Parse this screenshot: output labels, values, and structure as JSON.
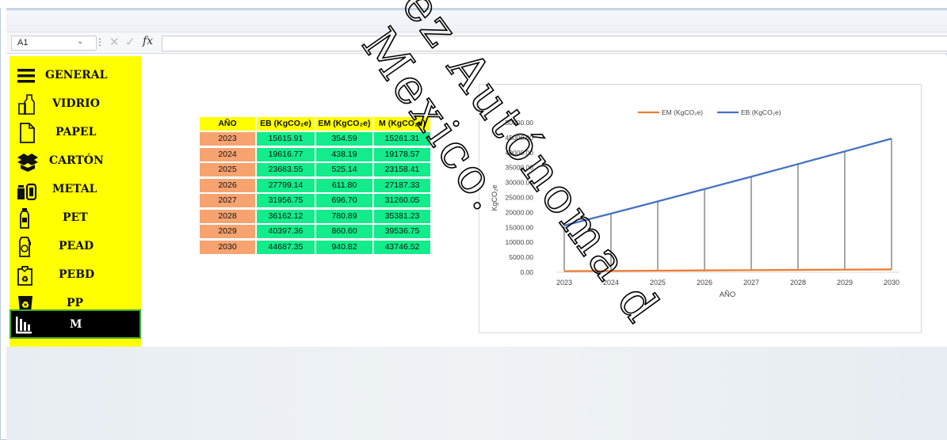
{
  "formula_bar": {
    "name_box": "A1",
    "fx": "fx"
  },
  "menu": {
    "items": [
      {
        "label": "GENERAL",
        "icon": "hamburger-icon"
      },
      {
        "label": "VIDRIO",
        "icon": "bottle-jar-icon"
      },
      {
        "label": "PAPEL",
        "icon": "paper-sheet-icon"
      },
      {
        "label": "CARTÓN",
        "icon": "cardboard-box-icon"
      },
      {
        "label": "METAL",
        "icon": "metal-can-icon"
      },
      {
        "label": "PET",
        "icon": "pet-bottle-icon"
      },
      {
        "label": "PEAD",
        "icon": "detergent-bottle-icon"
      },
      {
        "label": "PEBD",
        "icon": "plastic-bag-recycle-icon"
      },
      {
        "label": "PP",
        "icon": "recycle-bin-icon"
      },
      {
        "label": "M",
        "icon": "bar-chart-icon"
      }
    ],
    "active": "M"
  },
  "table": {
    "headers": [
      "AÑO",
      "EB (KgCO₂e)",
      "EM (KgCO₂e)",
      "M (KgCO₂e)"
    ],
    "rows": [
      [
        "2023",
        "15615.91",
        "354.59",
        "15261.31"
      ],
      [
        "2024",
        "19616.77",
        "438.19",
        "19178.57"
      ],
      [
        "2025",
        "23683.55",
        "525.14",
        "23158.41"
      ],
      [
        "2026",
        "27799.14",
        "611.80",
        "27187.33"
      ],
      [
        "2027",
        "31956.75",
        "696.70",
        "31260.05"
      ],
      [
        "2028",
        "36162.12",
        "780.89",
        "35381.23"
      ],
      [
        "2029",
        "40397.36",
        "860.60",
        "39536.75"
      ],
      [
        "2030",
        "44687.35",
        "940.82",
        "43746.52"
      ]
    ]
  },
  "chart_data": {
    "type": "line",
    "title": "",
    "xlabel": "AÑO",
    "ylabel": "KgCO₂e",
    "x": [
      "2023",
      "2024",
      "2025",
      "2026",
      "2027",
      "2028",
      "2029",
      "2030"
    ],
    "ylim": [
      0,
      50000
    ],
    "yticks": [
      "0.00",
      "5000.00",
      "10000.00",
      "15000.00",
      "20000.00",
      "25000.00",
      "30000.00",
      "35000.00",
      "40000.00",
      "45000.00",
      "50000.00"
    ],
    "legend": "top",
    "drop_lines": true,
    "series": [
      {
        "name": "EM (KgCO₂e)",
        "color": "#ed7d31",
        "values": [
          354.59,
          438.19,
          525.14,
          611.8,
          696.7,
          780.89,
          860.6,
          940.82
        ]
      },
      {
        "name": "EB (KgCO₂e)",
        "color": "#4472c4",
        "values": [
          15615.91,
          19616.77,
          23683.55,
          27799.14,
          31956.75,
          36162.12,
          40397.36,
          44687.35
        ]
      }
    ]
  },
  "watermark": {
    "lines": [
      "ez Autónoma d",
      "Mexico."
    ]
  },
  "colors": {
    "menu_bg": "#ffff00",
    "year_cell": "#f7a36f",
    "value_cell": "#12ec8a",
    "header_cell": "#ffff00"
  }
}
